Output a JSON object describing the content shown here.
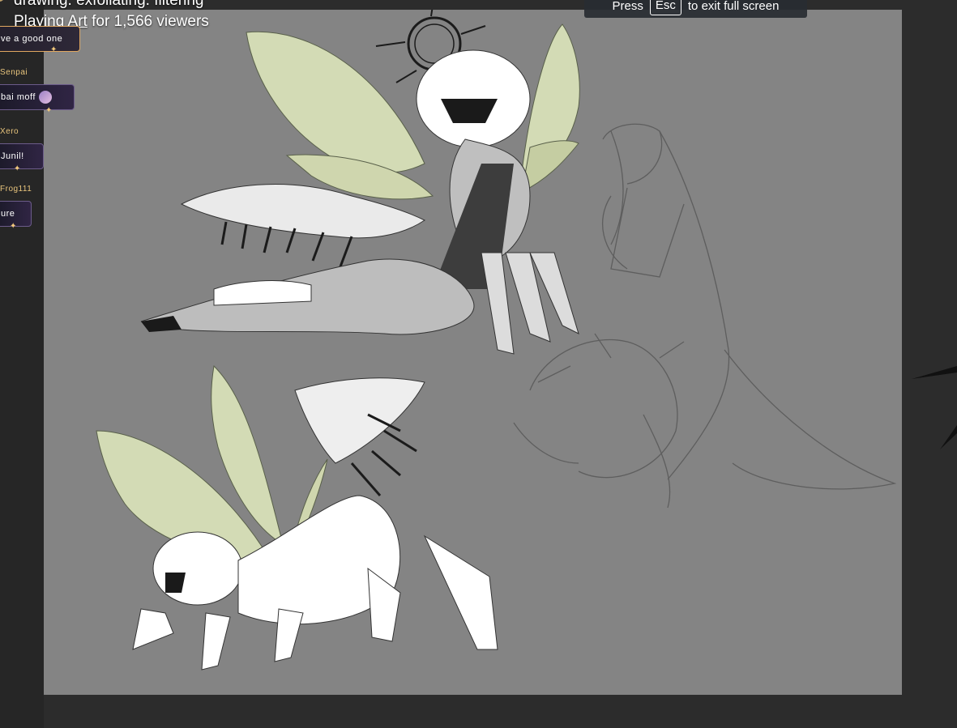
{
  "stream": {
    "title": "drawing. exfoliating. filtering",
    "playing_prefix": "Playing ",
    "game": "Art",
    "viewers_text": " for 1,566 viewers",
    "badge_text": "e"
  },
  "fullscreen_banner": {
    "press": "Press",
    "key": "Esc",
    "suffix": "to exit full screen"
  },
  "chat": [
    {
      "name": "",
      "message": "ve a good one"
    },
    {
      "name": "Senpai",
      "message": "bai moff"
    },
    {
      "name": "Xero",
      "message": "Junil!"
    },
    {
      "name": "Frog111",
      "message": "ure"
    }
  ],
  "colors": {
    "canvas": "#848484",
    "background": "#2c2c2c",
    "wing": "#d3dbb5",
    "accent_gold": "#e8c47c"
  },
  "icons": {
    "chat_emote": "avatar-emote-icon",
    "sparkle": "sparkle-icon"
  }
}
